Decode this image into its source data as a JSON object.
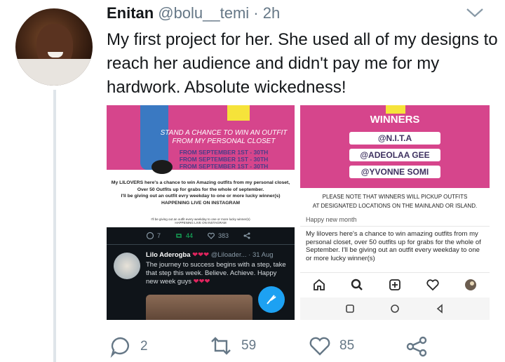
{
  "tweet": {
    "name": "Enitan",
    "handle": "@bolu__temi · 2h",
    "text": "My first project for her. She used all of my designs to reach her audience and didn't pay me for my hardwork. Absolute wickedness!"
  },
  "images": {
    "flyer1": {
      "headline": "STAND A CHANCE TO WIN AN OUTFIT FROM MY PERSONAL CLOSET",
      "dates": [
        "FROM SEPTEMBER 1ST - 30TH",
        "FROM SEPTEMBER 1ST - 30TH",
        "FROM SEPTEMBER 1ST - 30TH"
      ],
      "body_line1": "My LILOVERS here's a chance to win Amazing outfits from my personal closet,",
      "body_line2": "Over 50 Outfits up for grabs for the whole of september.",
      "body_line3": "I'll be giving out an outfit evry weekday to one or more lucky winner(s)",
      "body_line4": "HAPPENING LIVE ON INSTAGRAM"
    },
    "flyer2": {
      "title": "WINNERS",
      "winners": [
        "@N.I.T.A",
        "@ADEOLAA GEE",
        "@YVONNE SOMI"
      ],
      "note_line1": "PLEASE NOTE THAT WINNERS WILL PICKUP OUTFITS",
      "note_line2": "AT DESIGNATED LOCATIONS ON THE MAINLAND OR ISLAND."
    },
    "twitter_shot": {
      "strip_line1": "I'll be giving out an outfit every weekday to one or more lucky winner(s)",
      "strip_line2": "HAPPENING LIVE ON INSTAGRAM",
      "replies": "7",
      "retweets": "44",
      "likes": "383",
      "author": "Lilo Aderogba",
      "author_meta": "@Liloader... · 31 Aug",
      "text": "The journey to success begins with a step, take that step this week. Believe. Achieve. Happy new week guys"
    },
    "instagram_shot": {
      "top": "Happy new month",
      "caption": "My liIovers here's a chance to win amazing outfits from my personal closet, over 50 outfits up for grabs for the whole of September. I'll be giving out an outfit every weekday to one or more lucky winner(s)"
    }
  },
  "actions": {
    "replies": "2",
    "retweets": "59",
    "likes": "85"
  },
  "colors": {
    "flyer_pink": "#d6458c",
    "twitter_blue": "#1da1f2",
    "text_gray": "#657786"
  }
}
